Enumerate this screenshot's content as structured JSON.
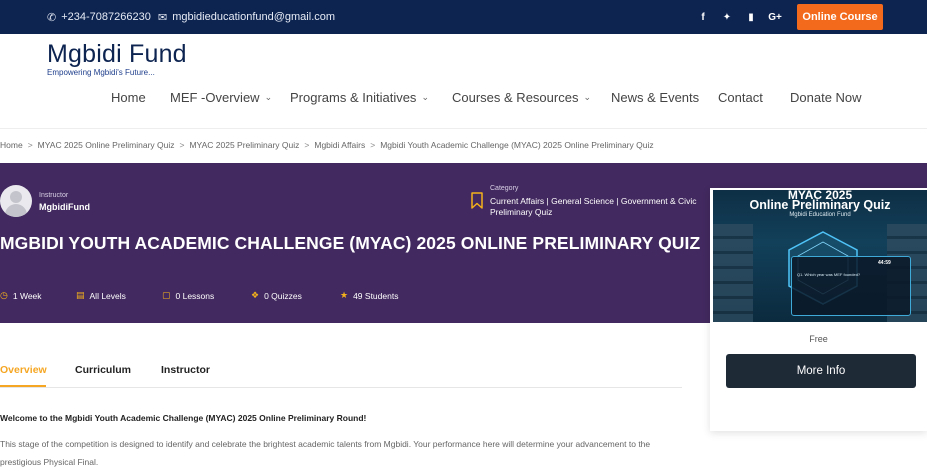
{
  "topbar": {
    "phone": "+234-7087266230",
    "email": "mgbidieducationfund@gmail.com",
    "socials": [
      "f",
      "t",
      "yt",
      "G+"
    ],
    "online_course": "Online Course"
  },
  "header": {
    "logo_title": "Mgbidi Fund",
    "logo_tagline": "Empowering Mgbidi's Future..."
  },
  "nav": [
    {
      "label": "Home",
      "dropdown": false
    },
    {
      "label": "MEF -Overview",
      "dropdown": true
    },
    {
      "label": "Programs & Initiatives",
      "dropdown": true
    },
    {
      "label": "Courses & Resources",
      "dropdown": true
    },
    {
      "label": "News & Events",
      "dropdown": false
    },
    {
      "label": "Contact",
      "dropdown": false
    },
    {
      "label": "Donate Now",
      "dropdown": false
    }
  ],
  "breadcrumb": [
    "Home",
    "MYAC 2025 Online Preliminary Quiz",
    "MYAC 2025 Preliminary Quiz",
    "Mgbidi Affairs",
    "Mgbidi Youth Academic Challenge (MYAC) 2025 Online Preliminary Quiz"
  ],
  "course": {
    "instructor_label": "Instructor",
    "instructor_name": "MgbidiFund",
    "category_label": "Category",
    "category_value": "Current Affairs | General Science | Government & Civic Preliminary Quiz",
    "title": "MGBIDI YOUTH ACADEMIC CHALLENGE (MYAC) 2025 ONLINE PRELIMINARY QUIZ",
    "meta": {
      "duration": "1 Week",
      "level": "All Levels",
      "lessons": "0 Lessons",
      "quizzes": "0 Quizzes",
      "students": "49 Students"
    }
  },
  "card": {
    "thumb_line1": "MYAC 2025",
    "thumb_line2": "Online Preliminary Quiz",
    "thumb_line3": "Mgbidi Education Fund",
    "thumb_timer": "44:59",
    "thumb_question": "Q1. Which year was MEF founded?",
    "price": "Free",
    "more_info": "More Info"
  },
  "tabs": [
    {
      "label": "Overview",
      "active": true
    },
    {
      "label": "Curriculum",
      "active": false
    },
    {
      "label": "Instructor",
      "active": false
    }
  ],
  "content": {
    "welcome": "Welcome to the Mgbidi Youth Academic Challenge (MYAC) 2025 Online Preliminary Round!",
    "description": "This stage of the competition is designed to identify and celebrate the brightest academic talents from Mgbidi. Your performance here will determine your advancement to the prestigious Physical Final."
  },
  "colors": {
    "topbar": "#0d2451",
    "hero": "#42295f",
    "accent_orange": "#f36a1c",
    "accent_yellow": "#f5a623",
    "button_dark": "#1f2a37"
  }
}
